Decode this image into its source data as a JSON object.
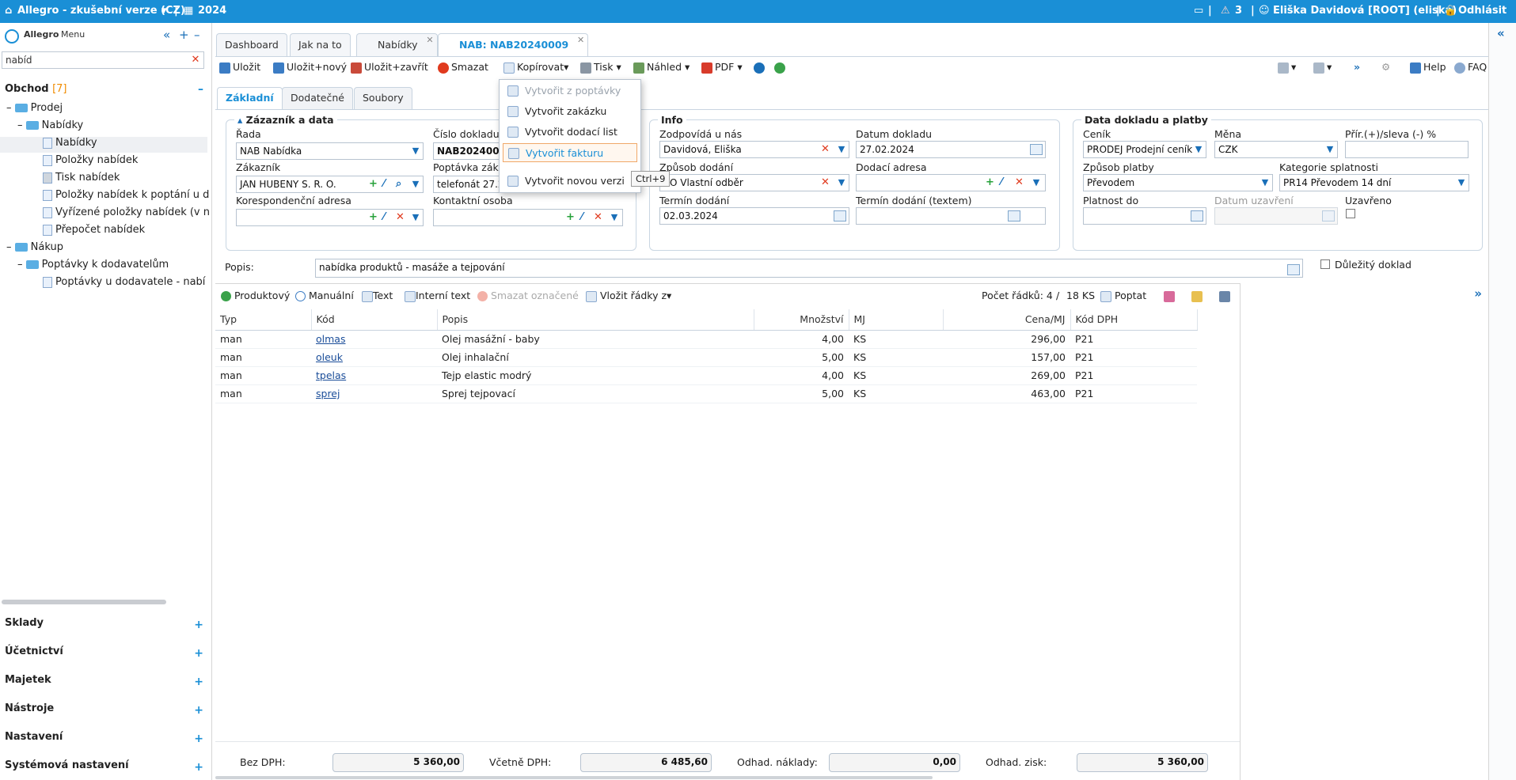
{
  "topbar": {
    "app_title": "Allegro - zkušební verze (CZ)",
    "year": "2024",
    "alerts": "3",
    "user": "Eliška Davidová [ROOT] (eliska)",
    "logout": "Odhlásit"
  },
  "sidebar": {
    "brand": "Allegro",
    "menu": "Menu",
    "search_value": "nabíd",
    "section_obchod": "Obchod",
    "obchod_count": "[7]",
    "tree": [
      "Prodej",
      "Nabídky",
      "Nabídky",
      "Položky nabídek",
      "Tisk nabídek",
      "Položky nabídek k poptání u d",
      "Vyřízené položky nabídek (v n",
      "Přepočet nabídek",
      "Nákup",
      "Poptávky k dodavatelům",
      "Poptávky u dodavatele - nabí"
    ],
    "sections": [
      "Sklady",
      "Účetnictví",
      "Majetek",
      "Nástroje",
      "Nastavení",
      "Systémová nastavení"
    ]
  },
  "tabs": [
    "Dashboard",
    "Jak na to",
    "Nabídky",
    "NAB: NAB20240009"
  ],
  "toolbar": {
    "save": "Uložit",
    "save_new": "Uložit+nový",
    "save_close": "Uložit+zavřít",
    "delete": "Smazat",
    "copy": "Kopírovat",
    "print": "Tisk",
    "preview": "Náhled",
    "pdf": "PDF",
    "help": "Help",
    "faq": "FAQ"
  },
  "subtabs": [
    "Základní",
    "Dodatečné",
    "Soubory"
  ],
  "copy_menu": {
    "items": [
      "Vytvořit z poptávky",
      "Vytvořit zakázku",
      "Vytvořit dodací list",
      "Vytvořit fakturu",
      "Vytvořit novou verzi"
    ],
    "shortcut": "Ctrl+9"
  },
  "panel1": {
    "title": "Zázazník a data",
    "rada_label": "Řada",
    "rada_value": "NAB Nabídka",
    "cislo_label": "Číslo dokladu",
    "cislo_value": "NAB20240009",
    "zakaznik_label": "Zákazník",
    "zakaznik_value": "JAN HUBENY S. R. O.",
    "poptavka_label": "Poptávka zákaz",
    "poptavka_value": "telefonát 27.2.",
    "koresp_label": "Korespondenční adresa",
    "kontakt_label": "Kontaktní osoba"
  },
  "panel2": {
    "title": "Info",
    "zodp_label": "Zodpovídá u nás",
    "zodp_value": "Davidová, Eliška",
    "datum_label": "Datum dokladu",
    "datum_value": "27.02.2024",
    "zpusob_label": "Způsob dodání",
    "zpusob_value": "VO Vlastní odběr",
    "dodaci_label": "Dodací adresa",
    "termin_label": "Termín dodání",
    "termin_value": "02.03.2024",
    "termin_text_label": "Termín dodání (textem)"
  },
  "panel3": {
    "title": "Data dokladu a platby",
    "cenik_label": "Ceník",
    "cenik_value": "PRODEJ Prodejní ceník",
    "mena_label": "Měna",
    "mena_value": "CZK",
    "prir_label": "Přír.(+)/sleva (-) %",
    "platba_label": "Způsob platby",
    "platba_value": "Převodem",
    "kategorie_label": "Kategorie splatnosti",
    "kategorie_value": "PR14 Převodem 14 dní",
    "platnost_label": "Platnost do",
    "uzavreni_label": "Datum uzavření",
    "uzavreno_label": "Uzavřeno"
  },
  "popis": {
    "label": "Popis:",
    "value": "nabídka produktů - masáže a tejpování",
    "important": "Důležitý doklad"
  },
  "grid_toolbar": {
    "produktovy": "Produktový",
    "manualni": "Manuální",
    "text": "Text",
    "interni": "Interní text",
    "smazat": "Smazat označené",
    "vlozit": "Vložit řádky z",
    "pocet": "Počet řádků: 4",
    "sep": "/",
    "ks": "18 KS",
    "poptat": "Poptat"
  },
  "grid": {
    "columns": [
      "Typ",
      "Kód",
      "Popis",
      "Množství",
      "MJ",
      "Cena/MJ",
      "Kód DPH"
    ],
    "rows": [
      [
        "man",
        "olmas",
        "Olej masážní - baby",
        "4,00",
        "KS",
        "296,00",
        "P21"
      ],
      [
        "man",
        "oleuk",
        "Olej inhalační",
        "5,00",
        "KS",
        "157,00",
        "P21"
      ],
      [
        "man",
        "tpelas",
        "Tejp elastic modrý",
        "4,00",
        "KS",
        "269,00",
        "P21"
      ],
      [
        "man",
        "sprej",
        "Sprej tejpovací",
        "5,00",
        "KS",
        "463,00",
        "P21"
      ]
    ]
  },
  "totals": {
    "bez_dph_label": "Bez DPH:",
    "bez_dph": "5 360,00",
    "vc_dph_label": "Včetně DPH:",
    "vc_dph": "6 485,60",
    "naklady_label": "Odhad. náklady:",
    "naklady": "0,00",
    "zisk_label": "Odhad. zisk:",
    "zisk": "5 360,00"
  }
}
